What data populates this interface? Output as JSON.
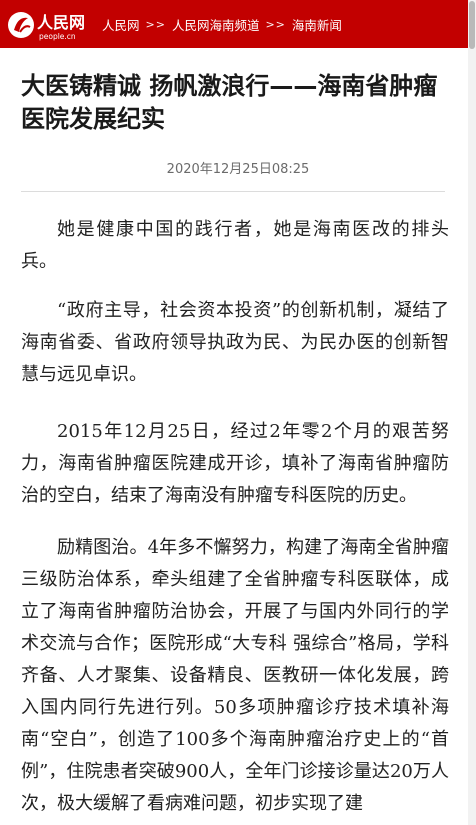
{
  "header": {
    "logo_text": "人民网",
    "logo_sub": "people.cn",
    "breadcrumb": [
      "人民网",
      "人民网海南频道",
      "海南新闻"
    ],
    "separator": ">>"
  },
  "article": {
    "title": "大医铸精诚 扬帆激浪行——海南省肿瘤医院发展纪实",
    "date": "2020年12月25日08:25",
    "paragraphs": [
      "她是健康中国的践行者，她是海南医改的排头兵。",
      "“政府主导，社会资本投资”的创新机制，凝结了海南省委、省政府领导执政为民、为民办医的创新智慧与远见卓识。",
      "2015年12月25日，经过2年零2个月的艰苦努力，海南省肿瘤医院建成开诊，填补了海南省肿瘤防治的空白，结束了海南没有肿瘤专科医院的历史。",
      "励精图治。4年多不懈努力，构建了海南全省肿瘤三级防治体系，牵头组建了全省肿瘤专科医联体，成立了海南省肿瘤防治协会，开展了与国内外同行的学术交流与合作；医院形成“大专科 强综合”格局，学科齐备、人才聚集、设备精良、医教研一体化发展，跨入国内同行先进行列。50多项肿瘤诊疗技术填补海南“空白”，创造了100多个海南肿瘤治疗史上的“首例”，住院患者突破900人，全年门诊接诊量达20万人次，极大缓解了看病难问题，初步实现了建"
    ]
  },
  "colors": {
    "brand_red": "#c20000",
    "text": "#222222",
    "meta": "#6b6b6b"
  }
}
